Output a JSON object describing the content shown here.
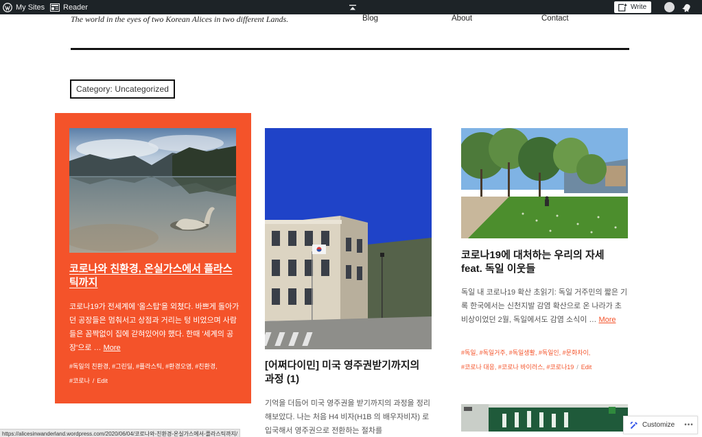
{
  "adminbar": {
    "my_sites": "My Sites",
    "reader": "Reader",
    "write": "Write"
  },
  "header": {
    "tagline": "The world in the eyes of two Korean Alices in two different Lands.",
    "nav": [
      "Blog",
      "About",
      "Contact"
    ]
  },
  "archive": {
    "title": "Category: Uncategorized"
  },
  "posts": [
    {
      "title": "코로나와 친환경, 온실가스에서 플라스틱까지",
      "excerpt": "코로나19가 전세계에 '올스탑'을 외쳤다. 바쁘게 돌아가던 공장들은 멈춰서고 상점과 거리는 텅 비었으며 사람들은 꼼짝없이 집에 갇혀있어야 했다. 한때 '세계의 공장'으로 … ",
      "more": "More",
      "tags": "#독일의 친환경, #그린딜, #플라스틱, #환경오염, #친환경,",
      "tags2": "#코로나",
      "edit": "Edit",
      "separator": "/"
    },
    {
      "title": "[어쩌다이민] 미국 영주권받기까지의 과정 (1)",
      "excerpt": "기억을 더듬어 미국 영주권을 받기까지의 과정을 정리해보았다. 나는 처음 H4 비자(H1B 의 배우자비자) 로 입국해서 영주권으로 전환하는 절차를"
    },
    {
      "title": "코로나19에 대처하는 우리의 자세 feat. 독일 이웃들",
      "excerpt": "독일 내 코로나19 확산 초읽기: 독일 거주민의 짧은 기록 한국에서는 신천지발 감염 확산으로 온 나라가 초비상이었던 2월, 독일에서도 감염 소식이 … ",
      "more": "More",
      "tags": "#독일, #독일거주, #독일생활, #독일인, #문화차이,",
      "tags2": "#코로나 대응, #코로나 바이러스, #코로나19",
      "edit": "Edit",
      "separator": "/"
    }
  ],
  "statusbar": {
    "url": "https://alicesinwanderland.wordpress.com/2020/06/04/코로나와-친환경-온실가스에서-플라스틱까지/"
  },
  "customize": {
    "label": "Customize",
    "more": "•••"
  },
  "colors": {
    "accent": "#f4532a",
    "adminbar": "#1d2327",
    "sky_blue": "#1f43c8"
  },
  "icons": {
    "my_sites": "wordpress-logo-icon",
    "reader": "reader-icon",
    "center": "caret-up-icon",
    "write": "write-plus-icon",
    "avatar": "user-avatar-icon",
    "notifications": "bell-icon",
    "customize": "pencil-brush-icon"
  }
}
